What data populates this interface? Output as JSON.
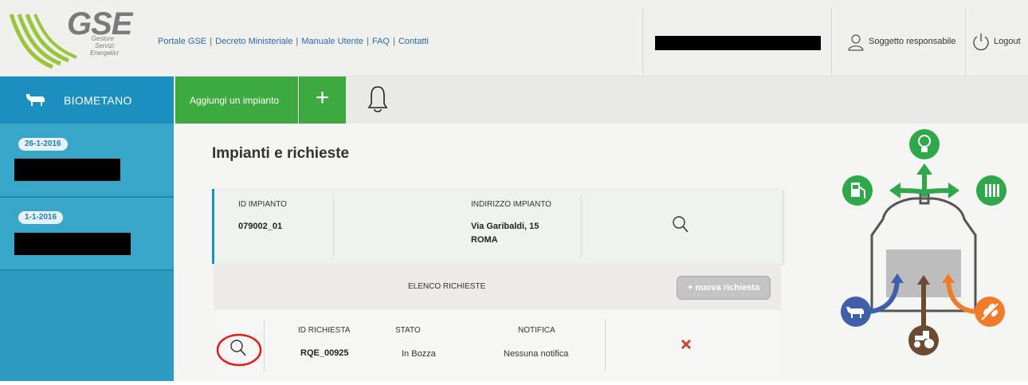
{
  "header": {
    "logo": {
      "name": "GSE",
      "subtitle_lines": [
        "Gestore",
        "Servizi",
        "Energetici"
      ]
    },
    "links": [
      "Portale GSE",
      "Decreto Ministeriale",
      "Manuale Utente",
      "FAQ",
      "Contatti"
    ],
    "link_separator": "|",
    "user_label": "Soggetto responsabile",
    "logout_label": "Logout"
  },
  "nav": {
    "section_label": "BIOMETANO",
    "add_plant_label": "Aggiungi un impianto",
    "plus_label": "+"
  },
  "sidebar": {
    "items": [
      {
        "date": "26-1-2016"
      },
      {
        "date": "1-1-2016"
      }
    ]
  },
  "main": {
    "title": "Impianti e richieste",
    "plant": {
      "id_label": "ID IMPIANTO",
      "id_value": "079002_01",
      "address_label": "INDIRIZZO IMPIANTO",
      "address_line1": "Via Garibaldi, 15",
      "address_line2": "ROMA"
    },
    "requests": {
      "list_label": "ELENCO RICHIESTE",
      "new_request_label": "+ nuova richiesta",
      "columns": [
        "ID RICHIESTA",
        "STATO",
        "NOTIFICA"
      ],
      "rows": [
        {
          "id": "RQE_00925",
          "status": "In Bozza",
          "notification": "Nessuna notifica"
        }
      ]
    }
  },
  "colors": {
    "brand_blue": "#1b8fbe",
    "sidebar_blue": "#2e9cc0",
    "action_green": "#3daa3f",
    "icon_green": "#2fa84a",
    "cow_blue": "#3f5fa8",
    "tractor_brown": "#6b4a34",
    "wheat_orange": "#f07c2a",
    "delete_red": "#d33b2f",
    "highlight_circle": "#e21b1b"
  },
  "icons": [
    "cow-icon",
    "bell-icon",
    "user-icon",
    "power-icon",
    "search-icon",
    "delete-icon",
    "lightbulb-icon",
    "fuel-pump-icon",
    "radiator-icon",
    "tractor-icon",
    "wheat-icon"
  ]
}
